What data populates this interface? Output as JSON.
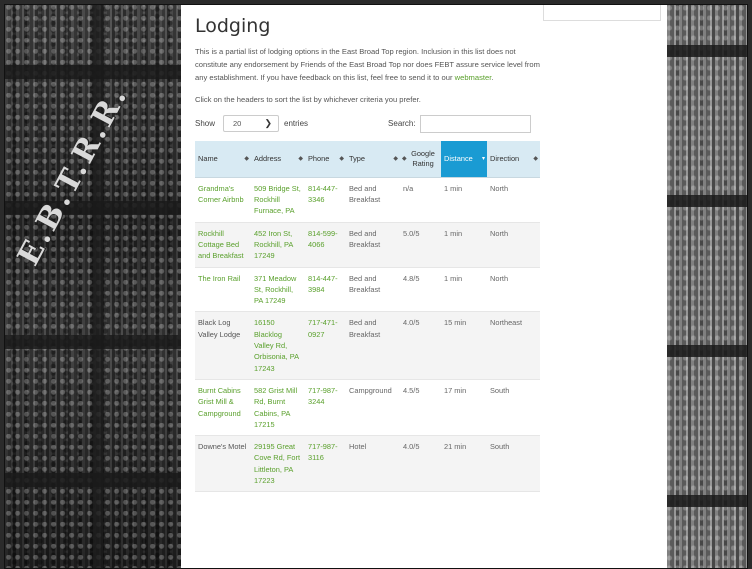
{
  "page": {
    "title": "Lodging",
    "intro_text": "This is a partial list of lodging options in the East Broad Top region. Inclusion in this list does not constitute any endorsement by Friends of the East Broad Top nor does FEBT assure service level from any establishment. If you have feedback on this list, feel free to send it to our ",
    "intro_link": "webmaster",
    "intro_end": ".",
    "sort_hint": "Click on the headers to sort the list by whichever criteria you prefer.",
    "stamp_text": "E.B.T.R.R."
  },
  "controls": {
    "show_label": "Show",
    "show_value": "20",
    "entries_label": "entries",
    "search_label": "Search:"
  },
  "table": {
    "headers": {
      "name": "Name",
      "address": "Address",
      "phone": "Phone",
      "type": "Type",
      "rating": "Google Rating",
      "distance": "Distance",
      "direction": "Direction"
    },
    "rows": [
      {
        "name": "Grandma's Corner Airbnb",
        "address": "509 Bridge St, Rockhill Furnace, PA",
        "phone": "814-447-3346",
        "type": "Bed and Breakfast",
        "rating": "n/a",
        "distance": "1 min",
        "direction": "North"
      },
      {
        "name": "Rockhill Cottage Bed and Breakfast",
        "address": "452 Iron St, Rockhill, PA 17249",
        "phone": "814-599-4066",
        "type": "Bed and Breakfast",
        "rating": "5.0/5",
        "distance": "1 min",
        "direction": "North"
      },
      {
        "name": "The Iron Rail",
        "address": "371 Meadow St, Rockhill, PA 17249",
        "phone": "814-447-3984",
        "type": "Bed and Breakfast",
        "rating": "4.8/5",
        "distance": "1 min",
        "direction": "North"
      },
      {
        "name": "Black Log Valley Lodge",
        "address": "16150 Blacklog Valley Rd, Orbisonia, PA 17243",
        "phone": "717-471-0927",
        "type": "Bed and Breakfast",
        "rating": "4.0/5",
        "distance": "15 min",
        "direction": "Northeast"
      },
      {
        "name": "Burnt Cabins Grist Mill & Campground",
        "address": "582 Grist Mill Rd, Burnt Cabins, PA 17215",
        "phone": "717-987-3244",
        "type": "Campground",
        "rating": "4.5/5",
        "distance": "17 min",
        "direction": "South"
      },
      {
        "name": "Downe's Motel",
        "address": "29195 Great Cove Rd, Fort Littleton, PA 17223",
        "phone": "717-987-3116",
        "type": "Hotel",
        "rating": "4.0/5",
        "distance": "21 min",
        "direction": "South"
      }
    ]
  }
}
